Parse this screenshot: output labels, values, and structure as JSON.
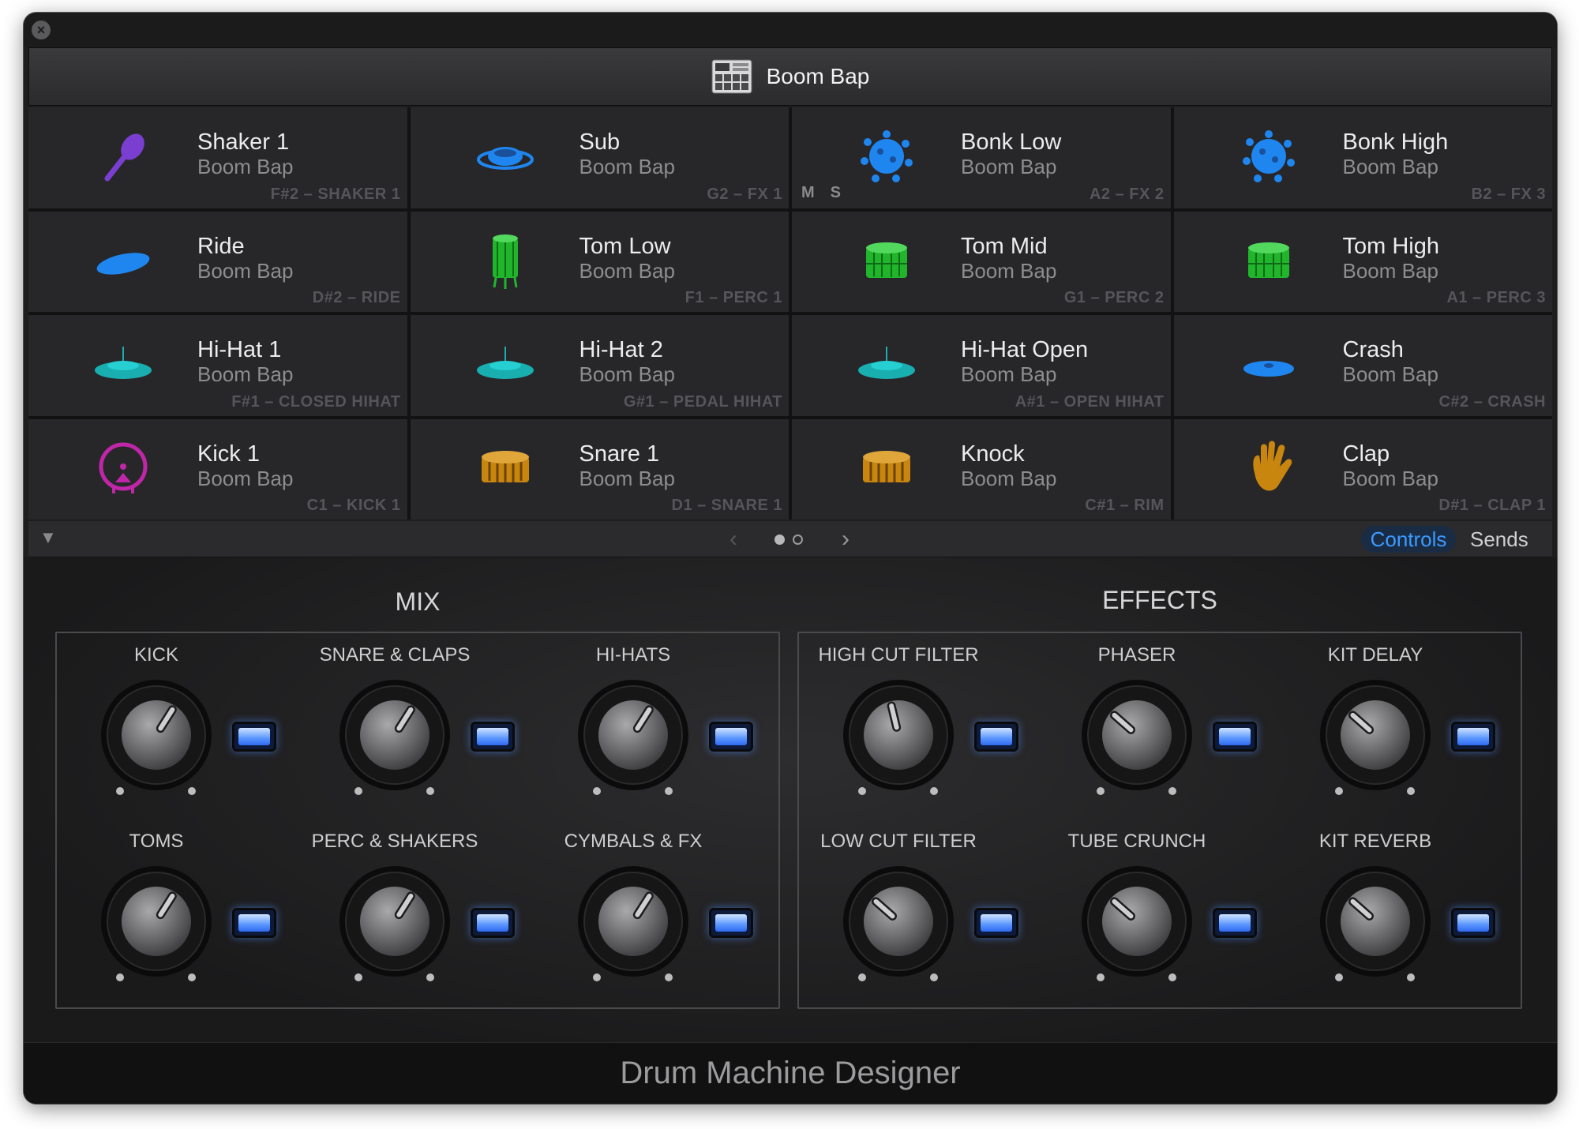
{
  "window": {
    "close_glyph": "×"
  },
  "kit": {
    "name": "Boom Bap",
    "icon": "drum-machine-icon"
  },
  "pads": [
    {
      "name": "Shaker 1",
      "kit": "Boom Bap",
      "note": "F#2 – SHAKER 1",
      "icon": "shaker-icon",
      "color": "#7a3fd0"
    },
    {
      "name": "Sub",
      "kit": "Boom Bap",
      "note": "G2 – FX 1",
      "icon": "sub-icon",
      "color": "#1f86f0"
    },
    {
      "name": "Bonk Low",
      "kit": "Boom Bap",
      "note": "A2 – FX 2",
      "icon": "splash-icon",
      "color": "#1f86f0",
      "mute": "M",
      "solo": "S"
    },
    {
      "name": "Bonk High",
      "kit": "Boom Bap",
      "note": "B2 – FX 3",
      "icon": "splash-icon",
      "color": "#1f86f0"
    },
    {
      "name": "Ride",
      "kit": "Boom Bap",
      "note": "D#2 – RIDE",
      "icon": "ride-cymbal-icon",
      "color": "#1f86f0"
    },
    {
      "name": "Tom Low",
      "kit": "Boom Bap",
      "note": "F1 – PERC 1",
      "icon": "floor-tom-icon",
      "color": "#21b52c"
    },
    {
      "name": "Tom Mid",
      "kit": "Boom Bap",
      "note": "G1 – PERC 2",
      "icon": "tom-icon",
      "color": "#21b52c"
    },
    {
      "name": "Tom High",
      "kit": "Boom Bap",
      "note": "A1 – PERC 3",
      "icon": "tom-icon",
      "color": "#21b52c"
    },
    {
      "name": "Hi-Hat 1",
      "kit": "Boom Bap",
      "note": "F#1 – CLOSED HIHAT",
      "icon": "hihat-icon",
      "color": "#19aeb0"
    },
    {
      "name": "Hi-Hat 2",
      "kit": "Boom Bap",
      "note": "G#1 – PEDAL HIHAT",
      "icon": "hihat-icon",
      "color": "#19aeb0"
    },
    {
      "name": "Hi-Hat Open",
      "kit": "Boom Bap",
      "note": "A#1 – OPEN HIHAT",
      "icon": "hihat-icon",
      "color": "#19aeb0"
    },
    {
      "name": "Crash",
      "kit": "Boom Bap",
      "note": "C#2 – CRASH",
      "icon": "crash-cymbal-icon",
      "color": "#1f86f0"
    },
    {
      "name": "Kick 1",
      "kit": "Boom Bap",
      "note": "C1 – KICK 1",
      "icon": "kick-drum-icon",
      "color": "#c026a8"
    },
    {
      "name": "Snare 1",
      "kit": "Boom Bap",
      "note": "D1 – SNARE 1",
      "icon": "snare-drum-icon",
      "color": "#c8860e"
    },
    {
      "name": "Knock",
      "kit": "Boom Bap",
      "note": "C#1 – RIM",
      "icon": "snare-drum-icon",
      "color": "#c8860e"
    },
    {
      "name": "Clap",
      "kit": "Boom Bap",
      "note": "D#1 – CLAP 1",
      "icon": "clap-hand-icon",
      "color": "#c8860e"
    }
  ],
  "tabbar": {
    "collapse_glyph": "▼",
    "prev_glyph": "‹",
    "next_glyph": "›",
    "page_index": 1,
    "page_count": 2,
    "tabs": [
      {
        "label": "Controls",
        "active": true
      },
      {
        "label": "Sends",
        "active": false
      }
    ]
  },
  "mix": {
    "title": "MIX",
    "controls": [
      {
        "label": "KICK",
        "value": 0.62,
        "led_on": true
      },
      {
        "label": "SNARE & CLAPS",
        "value": 0.62,
        "led_on": true
      },
      {
        "label": "HI-HATS",
        "value": 0.62,
        "led_on": true
      },
      {
        "label": "TOMS",
        "value": 0.62,
        "led_on": true
      },
      {
        "label": "PERC & SHAKERS",
        "value": 0.62,
        "led_on": true
      },
      {
        "label": "CYMBALS & FX",
        "value": 0.62,
        "led_on": true
      }
    ]
  },
  "effects": {
    "title": "EFFECTS",
    "controls": [
      {
        "label": "HIGH CUT FILTER",
        "value": 0.45,
        "led_on": true
      },
      {
        "label": "PHASER",
        "value": 0.32,
        "led_on": true
      },
      {
        "label": "KIT DELAY",
        "value": 0.32,
        "led_on": true
      },
      {
        "label": "LOW CUT FILTER",
        "value": 0.32,
        "led_on": true
      },
      {
        "label": "TUBE CRUNCH",
        "value": 0.32,
        "led_on": true
      },
      {
        "label": "KIT REVERB",
        "value": 0.32,
        "led_on": true
      }
    ]
  },
  "footer": {
    "title": "Drum Machine Designer"
  },
  "colors": {
    "accent": "#3c9bff",
    "led": "#5a96ff"
  }
}
